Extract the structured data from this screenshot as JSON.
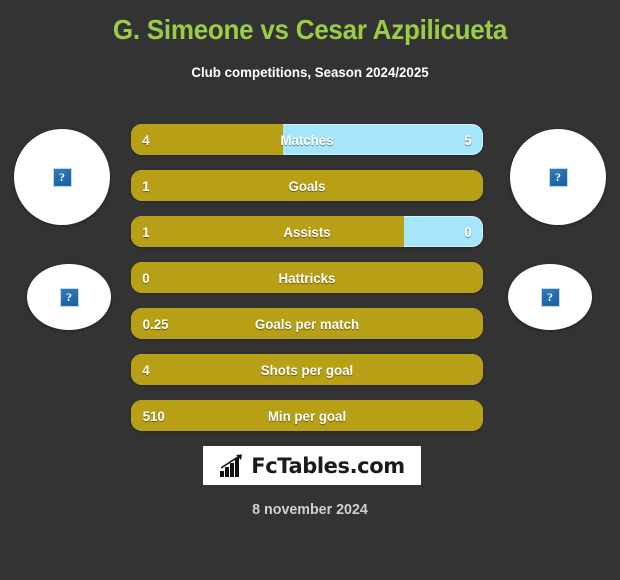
{
  "header": {
    "title": "G. Simeone vs Cesar Azpilicueta",
    "subtitle": "Club competitions, Season 2024/2025",
    "title_color": "#9acd45"
  },
  "colors": {
    "background": "#333333",
    "home_bar": "#b8a016",
    "away_bar": "#a5e6fb",
    "title_green": "#9acd45",
    "text": "#ffffff"
  },
  "avatars": [
    {
      "name": "home-player-photo-large",
      "alt": "?"
    },
    {
      "name": "away-player-photo-large",
      "alt": "?"
    },
    {
      "name": "home-team-logo",
      "alt": "?"
    },
    {
      "name": "away-team-logo",
      "alt": "?"
    }
  ],
  "comparison": {
    "rows": [
      {
        "label": "Matches",
        "home": "4",
        "away": "5",
        "home_pct": 43.2,
        "show_away": true
      },
      {
        "label": "Goals",
        "home": "1",
        "away": "",
        "home_pct": 100,
        "show_away": false
      },
      {
        "label": "Assists",
        "home": "1",
        "away": "0",
        "home_pct": 77.6,
        "show_away": true
      },
      {
        "label": "Hattricks",
        "home": "0",
        "away": "",
        "home_pct": 100,
        "show_away": false
      },
      {
        "label": "Goals per match",
        "home": "0.25",
        "away": "",
        "home_pct": 100,
        "show_away": false
      },
      {
        "label": "Shots per goal",
        "home": "4",
        "away": "",
        "home_pct": 100,
        "show_away": false
      },
      {
        "label": "Min per goal",
        "home": "510",
        "away": "",
        "home_pct": 100,
        "show_away": false
      }
    ]
  },
  "logo": {
    "text": "FcTables.com",
    "icon": "bar-chart-arrow-icon"
  },
  "footer": {
    "date": "8 november 2024"
  }
}
